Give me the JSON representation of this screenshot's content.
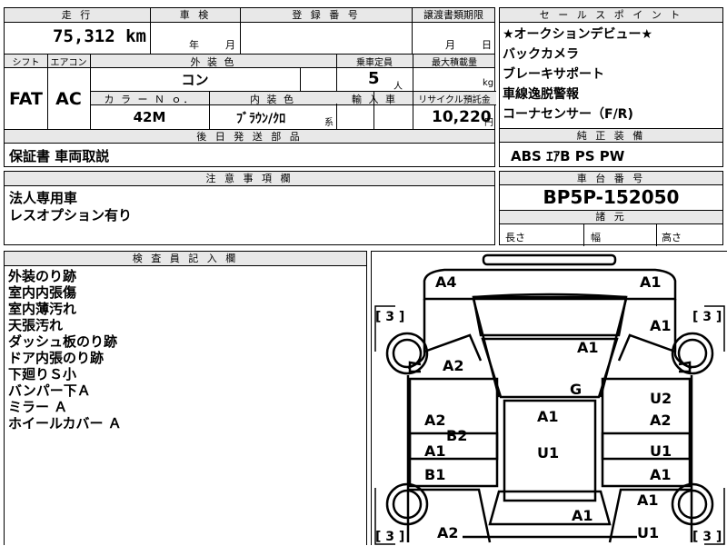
{
  "top_left": {
    "mileage_label": "走 行",
    "mileage_value": "75,312",
    "mileage_unit": "km",
    "inspection_label": "車 検",
    "inspection_year": "年",
    "inspection_month": "月",
    "registration_label": "登 録 番 号",
    "transfer_label": "譲渡書類期限",
    "transfer_month": "月",
    "transfer_day": "日"
  },
  "spec": {
    "shift_label": "シフト",
    "aircon_label": "エアコン",
    "exterior_label": "外 装 色",
    "capacity_label": "乗車定員",
    "max_load_label": "最大積載量",
    "shift_value": "FAT",
    "aircon_value": "AC",
    "exterior_value": "コン",
    "capacity_value": "5",
    "capacity_unit": "人",
    "max_load_unit": "kg",
    "color_no_label": "カ ラ ー Ｎ ｏ．",
    "interior_label": "内 装 色",
    "import_label": "輸 入 車",
    "recycle_label": "リサイクル預託金",
    "color_no_value": "42M",
    "interior_value": "ﾌﾞﾗｳﾝ/ｸﾛ",
    "interior_suffix": "系",
    "recycle_value": "10,220",
    "recycle_unit": "円"
  },
  "later_parts": {
    "label": "後 日 発 送 部 品",
    "value": "保証書 車両取説"
  },
  "notes": {
    "label": "注 意 事 項 欄",
    "lines": [
      "法人専用車",
      "レスオプション有り"
    ]
  },
  "sales_points": {
    "label": "セ ー ル ス ポ イ ン ト",
    "items": [
      "★オークションデビュー★",
      "バックカメラ",
      "ブレーキサポート",
      "車線逸脱警報",
      "コーナセンサー（F/R)"
    ]
  },
  "equipment": {
    "label": "純 正 装 備",
    "value": "ABS ｴｱB PS PW"
  },
  "chassis": {
    "label": "車 台 番 号",
    "value": "BP5P-152050"
  },
  "dimensions": {
    "label": "諸 元",
    "length": "長さ",
    "width": "幅",
    "height": "高さ"
  },
  "inspector": {
    "label": "検 査 員 記 入 欄",
    "items": [
      "外装のり跡",
      "室内内張傷",
      "室内薄汚れ",
      "天張汚れ",
      "ダッシュ板のり跡",
      "ドア内張のり跡",
      "下廻りＳ小",
      "バンパー下Ａ",
      "ミラー Ａ",
      "ホイールカバー Ａ"
    ]
  },
  "diagram": {
    "tire_marks": [
      "[ 3 ]",
      "[ 3 ]",
      "[ 3 ]",
      "[ 3 ]"
    ],
    "marks": [
      "A4",
      "A1",
      "A1",
      "A1",
      "A2",
      "G",
      "A2",
      "U2",
      "A1",
      "A2",
      "B2",
      "A1",
      "U1",
      "U1",
      "B1",
      "A1",
      "A1",
      "A1",
      "A2",
      "U1"
    ]
  }
}
